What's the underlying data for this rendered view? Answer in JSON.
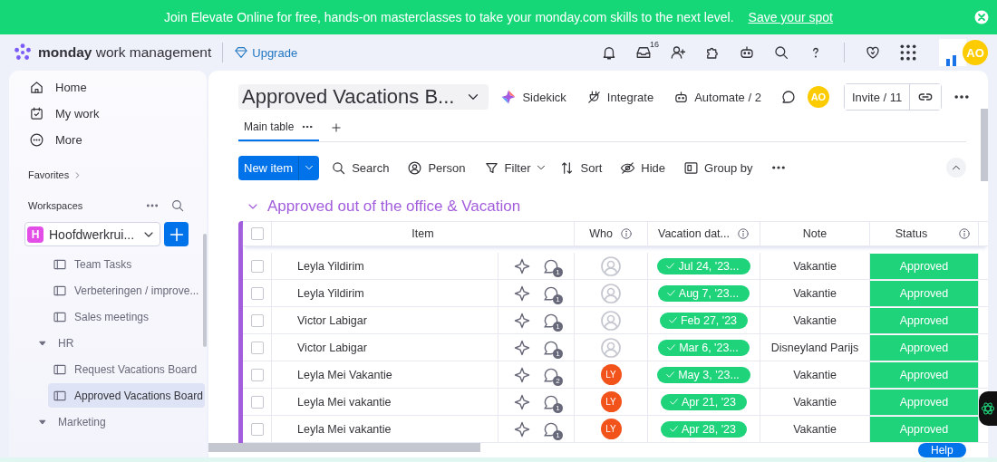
{
  "banner": {
    "text": "Join Elevate Online for free, hands-on masterclasses to take your monday.com skills to the next level.",
    "link": "Save your spot"
  },
  "topbar": {
    "brand": "monday",
    "product": "work management",
    "upgrade": "Upgrade",
    "inbox_count": "16",
    "avatar": "AO"
  },
  "sidebar": {
    "nav": [
      "Home",
      "My work",
      "More"
    ],
    "favorites": "Favorites",
    "workspaces": "Workspaces",
    "workspace": {
      "badge": "H",
      "name": "Hoofdwerkrui..."
    },
    "items": [
      {
        "kind": "board",
        "label": "Team Tasks",
        "selected": false
      },
      {
        "kind": "board",
        "label": "Verbeteringen / improve...",
        "selected": false
      },
      {
        "kind": "board",
        "label": "Sales meetings",
        "selected": false
      },
      {
        "kind": "folder",
        "label": "HR",
        "expanded": true,
        "children": [
          {
            "kind": "board",
            "label": "Request Vacations Board",
            "selected": false
          },
          {
            "kind": "board",
            "label": "Approved Vacations Board",
            "selected": true
          }
        ]
      },
      {
        "kind": "folder",
        "label": "Marketing",
        "expanded": true
      }
    ]
  },
  "board": {
    "title": "Approved Vacations B...",
    "sidekick": "Sidekick",
    "integrate": "Integrate",
    "automate": "Automate / 2",
    "avatar": "AO",
    "invite": "Invite / 11",
    "tabs": [
      {
        "label": "Main table",
        "selected": true
      }
    ],
    "toolbar": {
      "new_item": "New item",
      "search": "Search",
      "person": "Person",
      "filter": "Filter",
      "sort": "Sort",
      "hide": "Hide",
      "group_by": "Group by"
    },
    "group": {
      "title": "Approved out of the office & Vacation",
      "color": "#a25ddc"
    },
    "select_all_checked": false,
    "columns": [
      "Item",
      "Who",
      "Vacation dat...",
      "Note",
      "Status"
    ],
    "rows": [
      {
        "checked": false,
        "item": "Leyla Yildirim",
        "updates": "1",
        "who": null,
        "date": "Jul 24, '23...",
        "note": "Vakantie",
        "status": "Approved"
      },
      {
        "checked": false,
        "item": "Leyla Yildirim",
        "updates": "1",
        "who": null,
        "date": "Aug 7, '23...",
        "note": "Vakantie",
        "status": "Approved"
      },
      {
        "checked": false,
        "item": "Victor Labigar",
        "updates": "1",
        "who": null,
        "date": "Feb 27, '23",
        "note": "Vakantie",
        "status": "Approved"
      },
      {
        "checked": false,
        "item": "Victor Labigar",
        "updates": "1",
        "who": null,
        "date": "Mar 6, '23...",
        "note": "Disneyland Parijs",
        "status": "Approved"
      },
      {
        "checked": false,
        "item": "Leyla Mei Vakantie",
        "updates": "2",
        "who": "LY",
        "date": "May 3, '23...",
        "note": "Vakantie",
        "status": "Approved"
      },
      {
        "checked": false,
        "item": "Leyla Mei vakantie",
        "updates": "1",
        "who": "LY",
        "date": "Apr 21, '23",
        "note": "Vakantie",
        "status": "Approved"
      },
      {
        "checked": false,
        "item": "Leyla Mei vakantie",
        "updates": "1",
        "who": "LY",
        "date": "Apr 28, '23",
        "note": "Vakantie",
        "status": "Approved"
      }
    ]
  },
  "help": "Help"
}
